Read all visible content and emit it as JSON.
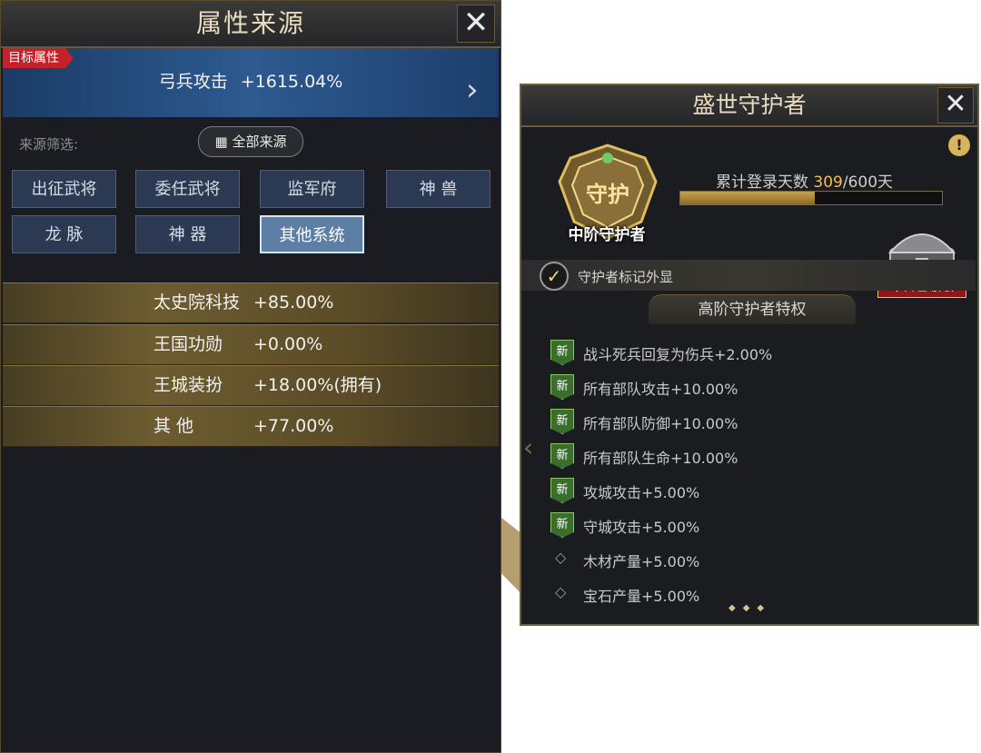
{
  "left_panel": {
    "title": "属性来源",
    "close_icon": "close-icon",
    "target": {
      "tag": "目标属性",
      "name": "弓兵攻击",
      "value": "+1615.04%"
    },
    "filter": {
      "label": "来源筛选:",
      "all_sources": "全部来源",
      "buttons": [
        {
          "label": "出征武将",
          "active": false
        },
        {
          "label": "委任武将",
          "active": false
        },
        {
          "label": "监军府",
          "active": false
        },
        {
          "label": "神 兽",
          "active": false
        },
        {
          "label": "龙 脉",
          "active": false
        },
        {
          "label": "神 器",
          "active": false
        },
        {
          "label": "其他系统",
          "active": true
        }
      ]
    },
    "sources": [
      {
        "name": "太史院科技",
        "value": "+85.00%"
      },
      {
        "name": "王国功勋",
        "value": "+0.00%"
      },
      {
        "name": "王城装扮",
        "value": "+18.00%(拥有)"
      },
      {
        "name": "其 他",
        "value": "+77.00%"
      }
    ]
  },
  "right_panel": {
    "title": "盛世守护者",
    "badge": {
      "emblem_text": "守护",
      "label": "中阶守护者"
    },
    "login": {
      "label": "累计登录天数",
      "current": "309",
      "target": "/600天",
      "progress": 0.515
    },
    "chest_status": "今日已领取",
    "mark_text": "守护者标记外显",
    "privilege_header": "高阶守护者特权",
    "perks": [
      {
        "icon": "new",
        "icon_text": "新",
        "text": "战斗死兵回复为伤兵+2.00%"
      },
      {
        "icon": "new",
        "icon_text": "新",
        "text": "所有部队攻击+10.00%"
      },
      {
        "icon": "new",
        "icon_text": "新",
        "text": "所有部队防御+10.00%"
      },
      {
        "icon": "new",
        "icon_text": "新",
        "text": "所有部队生命+10.00%"
      },
      {
        "icon": "new",
        "icon_text": "新",
        "text": "攻城攻击+5.00%"
      },
      {
        "icon": "new",
        "icon_text": "新",
        "text": "守城攻击+5.00%"
      },
      {
        "icon": "diamond",
        "icon_text": "",
        "text": "木材产量+5.00%"
      },
      {
        "icon": "diamond",
        "icon_text": "",
        "text": "宝石产量+5.00%"
      }
    ],
    "colors": {
      "accent_gold": "#f1c04c",
      "claimed_red": "#8e1818",
      "new_green": "#3a6e2c"
    }
  }
}
